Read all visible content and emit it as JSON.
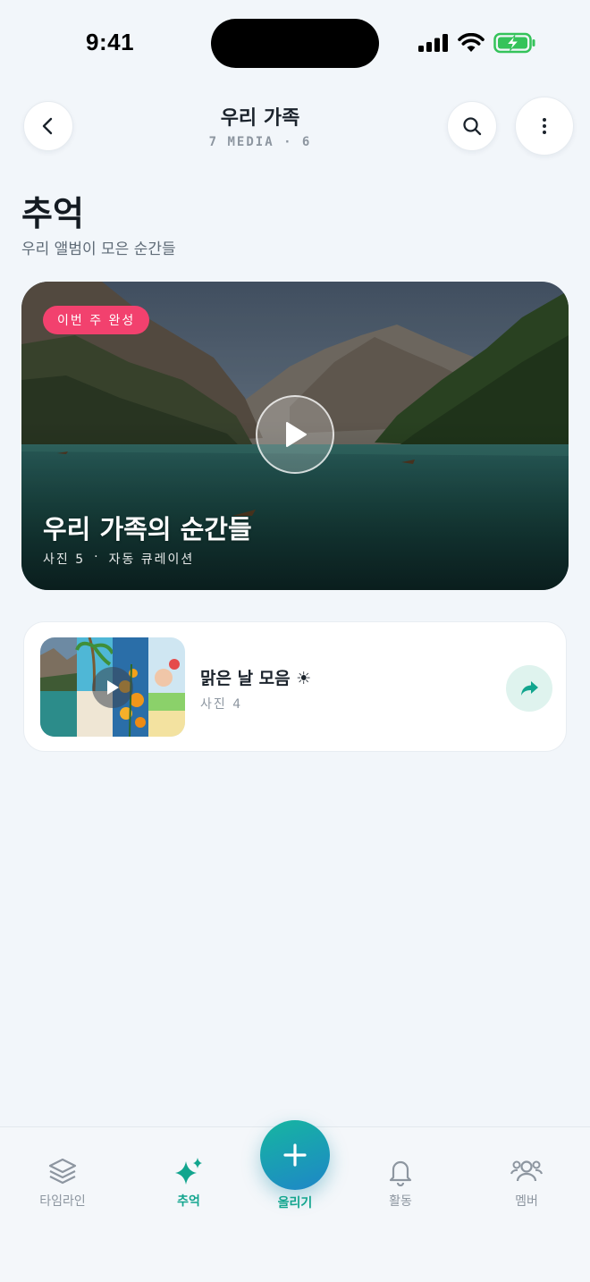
{
  "status_bar": {
    "time": "9:41"
  },
  "header": {
    "title": "우리 가족",
    "subtitle": "7 MEDIA · 6",
    "icons": {
      "back": "chevron-left-icon",
      "search": "search-icon",
      "more": "more-vertical-icon"
    }
  },
  "page": {
    "title": "추억",
    "subtitle": "우리 앨범이 모은 순간들"
  },
  "hero": {
    "badge": "이번 주 완성",
    "title": "우리 가족의 순간들",
    "meta_photos": "사진 5",
    "meta_separator": "·",
    "meta_type": "자동 큐레이션",
    "badge_color": "#f2416e"
  },
  "albums": [
    {
      "title": "맑은 날 모음 ☀",
      "count": "사진 4"
    }
  ],
  "bottom_nav": {
    "items": [
      {
        "label": "타임라인",
        "icon": "layers-icon"
      },
      {
        "label": "추억",
        "icon": "sparkle-icon"
      },
      {
        "label": "올리기",
        "icon": "plus-icon"
      },
      {
        "label": "활동",
        "icon": "bell-icon"
      },
      {
        "label": "멤버",
        "icon": "members-icon"
      }
    ],
    "active_index": 1,
    "accent_color": "#12a58e"
  }
}
